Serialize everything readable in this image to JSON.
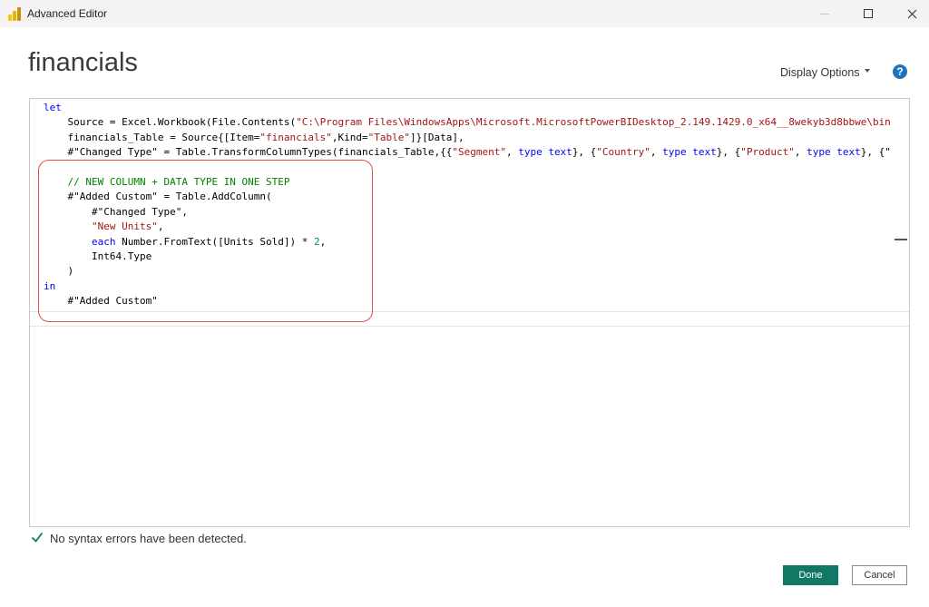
{
  "window": {
    "title": "Advanced Editor",
    "icon": "power-bi-logo",
    "controls": [
      "minimize",
      "maximize",
      "close"
    ]
  },
  "header": {
    "query_name": "financials",
    "display_options_label": "Display Options",
    "help_label": "?"
  },
  "editor": {
    "lines": [
      {
        "indent": "",
        "tokens": [
          {
            "t": "kw",
            "v": "let"
          }
        ]
      },
      {
        "indent": "    ",
        "tokens": [
          {
            "t": "pl",
            "v": "Source = Excel.Workbook(File.Contents("
          },
          {
            "t": "str",
            "v": "\"C:\\Program Files\\WindowsApps\\Microsoft.MicrosoftPowerBIDesktop_2.149.1429.0_x64__8wekyb3d8bbwe\\bin"
          }
        ]
      },
      {
        "indent": "    ",
        "tokens": [
          {
            "t": "pl",
            "v": "financials_Table = Source{[Item="
          },
          {
            "t": "str",
            "v": "\"financials\""
          },
          {
            "t": "pl",
            "v": ",Kind="
          },
          {
            "t": "str",
            "v": "\"Table\""
          },
          {
            "t": "pl",
            "v": "]}[Data],"
          }
        ]
      },
      {
        "indent": "    ",
        "tokens": [
          {
            "t": "pl",
            "v": "#\"Changed Type\" = Table.TransformColumnTypes(financials_Table,{{"
          },
          {
            "t": "str",
            "v": "\"Segment\""
          },
          {
            "t": "pl",
            "v": ", "
          },
          {
            "t": "kw",
            "v": "type text"
          },
          {
            "t": "pl",
            "v": "}, {"
          },
          {
            "t": "str",
            "v": "\"Country\""
          },
          {
            "t": "pl",
            "v": ", "
          },
          {
            "t": "kw",
            "v": "type text"
          },
          {
            "t": "pl",
            "v": "}, {"
          },
          {
            "t": "str",
            "v": "\"Product\""
          },
          {
            "t": "pl",
            "v": ", "
          },
          {
            "t": "kw",
            "v": "type text"
          },
          {
            "t": "pl",
            "v": "}, {\""
          }
        ]
      },
      {
        "indent": "",
        "tokens": []
      },
      {
        "indent": "    ",
        "tokens": [
          {
            "t": "com",
            "v": "// NEW COLUMN + DATA TYPE IN ONE STEP"
          }
        ]
      },
      {
        "indent": "    ",
        "tokens": [
          {
            "t": "pl",
            "v": "#\"Added Custom\" = Table.AddColumn("
          }
        ]
      },
      {
        "indent": "        ",
        "tokens": [
          {
            "t": "pl",
            "v": "#\"Changed Type\","
          }
        ]
      },
      {
        "indent": "        ",
        "tokens": [
          {
            "t": "str",
            "v": "\"New Units\""
          },
          {
            "t": "pl",
            "v": ","
          }
        ]
      },
      {
        "indent": "        ",
        "tokens": [
          {
            "t": "kw",
            "v": "each"
          },
          {
            "t": "pl",
            "v": " Number.FromText([Units Sold]) * "
          },
          {
            "t": "num",
            "v": "2"
          },
          {
            "t": "pl",
            "v": ","
          }
        ]
      },
      {
        "indent": "        ",
        "tokens": [
          {
            "t": "pl",
            "v": "Int64.Type"
          }
        ]
      },
      {
        "indent": "    ",
        "tokens": [
          {
            "t": "pl",
            "v": ")"
          }
        ]
      },
      {
        "indent": "",
        "tokens": [
          {
            "t": "kw",
            "v": "in"
          }
        ]
      },
      {
        "indent": "    ",
        "tokens": [
          {
            "t": "pl",
            "v": "#\"Added Custom\""
          }
        ]
      }
    ]
  },
  "status": {
    "icon": "checkmark-icon",
    "message": "No syntax errors have been detected."
  },
  "footer": {
    "done_label": "Done",
    "cancel_label": "Cancel"
  },
  "colors": {
    "keyword": "#0000ff",
    "string": "#a31515",
    "comment": "#008000",
    "number": "#098658",
    "done_button": "#117865",
    "highlight_box": "#e05050"
  }
}
